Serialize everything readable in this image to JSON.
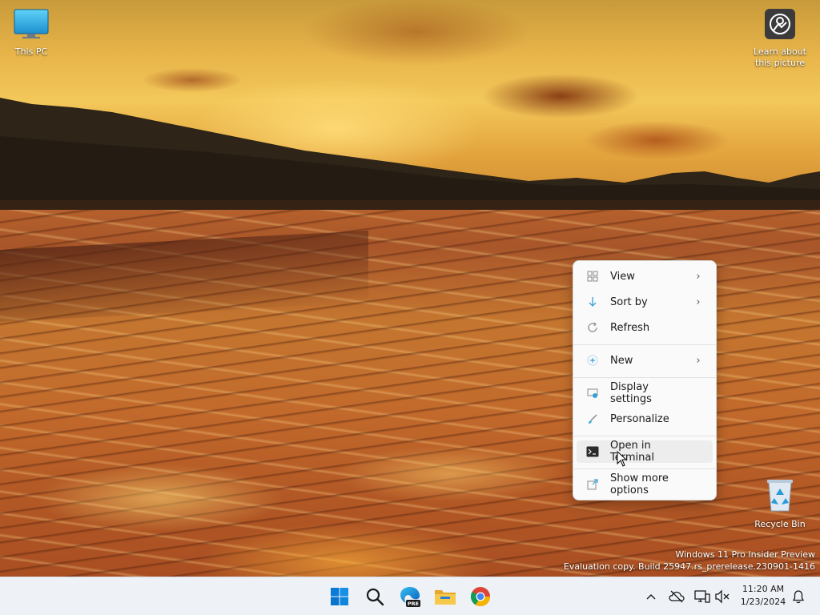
{
  "desktop": {
    "icons": [
      {
        "label": "This PC",
        "icon": "computer-icon"
      },
      {
        "label": "Learn about\nthis picture",
        "icon": "camera-icon"
      },
      {
        "label": "Recycle Bin",
        "icon": "recycle-bin-icon"
      }
    ],
    "watermark": {
      "line1": "Windows 11 Pro Insider Preview",
      "line2": "Evaluation copy. Build 25947.rs_prerelease.230901-1416"
    }
  },
  "context_menu": {
    "items": [
      {
        "label": "View",
        "icon": "view-grid-icon",
        "submenu": true
      },
      {
        "label": "Sort by",
        "icon": "sort-icon",
        "submenu": true
      },
      {
        "label": "Refresh",
        "icon": "refresh-icon",
        "submenu": false
      },
      {
        "label": "New",
        "icon": "plus-icon",
        "submenu": true
      },
      {
        "label": "Display settings",
        "icon": "display-settings-icon",
        "submenu": false
      },
      {
        "label": "Personalize",
        "icon": "brush-icon",
        "submenu": false
      },
      {
        "label": "Open in Terminal",
        "icon": "terminal-icon",
        "submenu": false,
        "highlighted": true
      },
      {
        "label": "Show more options",
        "icon": "external-icon",
        "submenu": false
      }
    ]
  },
  "taskbar": {
    "apps": [
      {
        "name": "Start",
        "icon": "windows-logo-icon"
      },
      {
        "name": "Search",
        "icon": "search-icon"
      },
      {
        "name": "Microsoft Edge Insider",
        "icon": "edge-pre-icon",
        "badge": "PRE"
      },
      {
        "name": "File Explorer",
        "icon": "folder-icon"
      },
      {
        "name": "Google Chrome",
        "icon": "chrome-icon"
      }
    ],
    "tray": {
      "time": "11:20 AM",
      "date": "1/23/2024"
    }
  },
  "colors": {
    "taskbar_bg": "#eef1f6",
    "menu_bg": "#fafafa",
    "menu_hover": "#ededed",
    "accent": "#0078d4"
  }
}
